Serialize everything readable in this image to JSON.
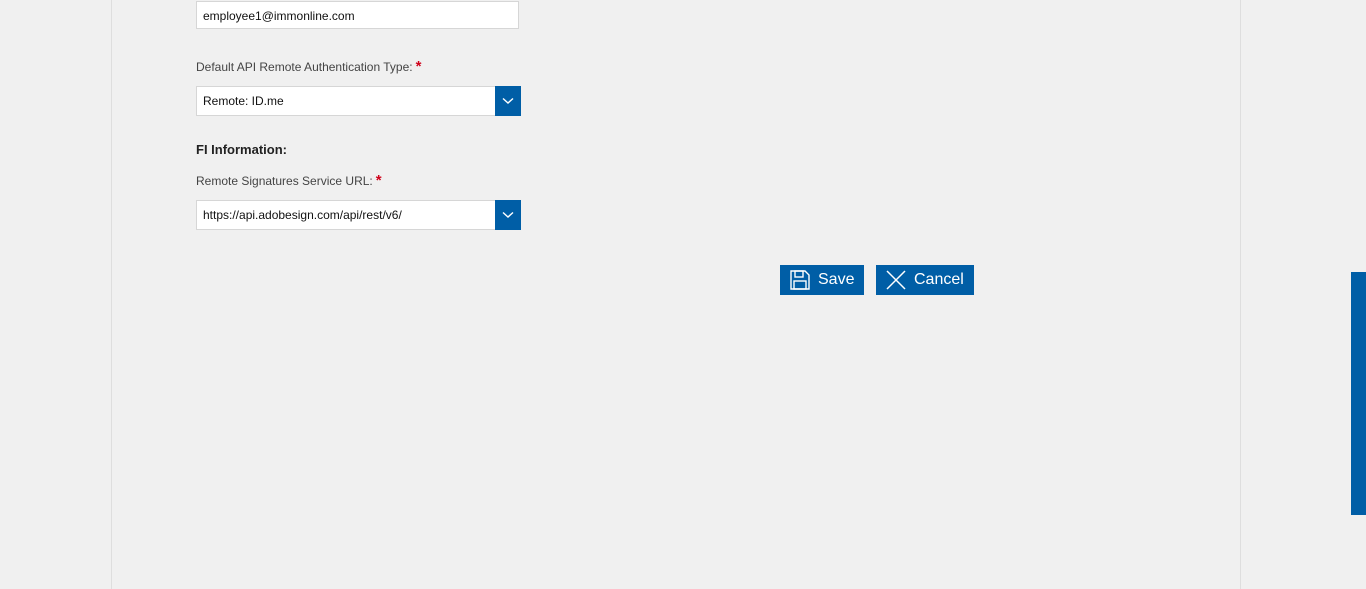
{
  "form": {
    "email_value": "employee1@immonline.com",
    "auth_type": {
      "label": "Default API Remote Authentication Type:",
      "required": "*",
      "selected": "Remote: ID.me"
    },
    "fi_section": {
      "title": "FI Information:"
    },
    "signatures_url": {
      "label": "Remote Signatures Service URL:",
      "required": "*",
      "selected": "https://api.adobesign.com/api/rest/v6/"
    }
  },
  "actions": {
    "save_label": "Save",
    "cancel_label": "Cancel"
  },
  "colors": {
    "accent": "#005ea6",
    "required": "#d0021b",
    "background": "#f0f0f0"
  },
  "icons": {
    "save": "floppy-disk-icon",
    "cancel": "x-close-icon",
    "dropdown": "chevron-down-icon"
  }
}
